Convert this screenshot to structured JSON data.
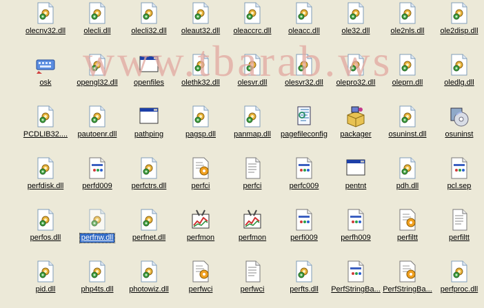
{
  "watermark": "www.tbarab.ws",
  "selected_index": 37,
  "colors": {
    "selection": "#316AC5",
    "background": "#ECE9D8"
  },
  "items": [
    {
      "label": "olecnv32.dll",
      "icon": "dll-icon"
    },
    {
      "label": "olecli.dll",
      "icon": "dll-icon"
    },
    {
      "label": "olecli32.dll",
      "icon": "dll-icon"
    },
    {
      "label": "oleaut32.dll",
      "icon": "dll-icon"
    },
    {
      "label": "oleaccrc.dll",
      "icon": "dll-icon"
    },
    {
      "label": "oleacc.dll",
      "icon": "dll-icon"
    },
    {
      "label": "ole32.dll",
      "icon": "dll-icon"
    },
    {
      "label": "ole2nls.dll",
      "icon": "dll-icon"
    },
    {
      "label": "ole2disp.dll",
      "icon": "dll-icon"
    },
    {
      "label": "osk",
      "icon": "keyboard-icon"
    },
    {
      "label": "opengl32.dll",
      "icon": "dll-icon"
    },
    {
      "label": "openfiles",
      "icon": "window-icon"
    },
    {
      "label": "olethk32.dll",
      "icon": "dll-icon"
    },
    {
      "label": "olesvr.dll",
      "icon": "dll-icon"
    },
    {
      "label": "olesvr32.dll",
      "icon": "dll-icon"
    },
    {
      "label": "olepro32.dll",
      "icon": "dll-icon"
    },
    {
      "label": "oleprn.dll",
      "icon": "dll-icon"
    },
    {
      "label": "oledlg.dll",
      "icon": "dll-icon"
    },
    {
      "label": "PCDLIB32....",
      "icon": "dll-icon"
    },
    {
      "label": "pautoenr.dll",
      "icon": "dll-icon"
    },
    {
      "label": "pathping",
      "icon": "window-icon"
    },
    {
      "label": "pagsp.dll",
      "icon": "dll-icon"
    },
    {
      "label": "panmap.dll",
      "icon": "dll-icon"
    },
    {
      "label": "pagefileconfig",
      "icon": "script-icon"
    },
    {
      "label": "packager",
      "icon": "packager-icon"
    },
    {
      "label": "osuninst.dll",
      "icon": "dll-icon"
    },
    {
      "label": "osuninst",
      "icon": "cd-install-icon"
    },
    {
      "label": "perfdisk.dll",
      "icon": "dll-icon"
    },
    {
      "label": "perfd009",
      "icon": "data-file-icon"
    },
    {
      "label": "perfctrs.dll",
      "icon": "dll-icon"
    },
    {
      "label": "perfci",
      "icon": "config-file-icon"
    },
    {
      "label": "perfci",
      "icon": "text-file-icon"
    },
    {
      "label": "perfc009",
      "icon": "data-file-icon"
    },
    {
      "label": "pentnt",
      "icon": "window-icon"
    },
    {
      "label": "pdh.dll",
      "icon": "dll-icon"
    },
    {
      "label": "pcl.sep",
      "icon": "data-file-icon"
    },
    {
      "label": "perfos.dll",
      "icon": "dll-icon"
    },
    {
      "label": "perfnw.dll",
      "icon": "dll-icon"
    },
    {
      "label": "perfnet.dll",
      "icon": "dll-icon"
    },
    {
      "label": "perfmon",
      "icon": "perfmon-icon"
    },
    {
      "label": "perfmon",
      "icon": "perfmon-icon"
    },
    {
      "label": "perfi009",
      "icon": "data-file-icon"
    },
    {
      "label": "perfh009",
      "icon": "data-file-icon"
    },
    {
      "label": "perfiltt",
      "icon": "config-file-icon"
    },
    {
      "label": "perfiltt",
      "icon": "text-file-icon"
    },
    {
      "label": "pid.dll",
      "icon": "dll-icon"
    },
    {
      "label": "php4ts.dll",
      "icon": "dll-icon"
    },
    {
      "label": "photowiz.dll",
      "icon": "dll-icon"
    },
    {
      "label": "perfwci",
      "icon": "config-file-icon"
    },
    {
      "label": "perfwci",
      "icon": "text-file-icon"
    },
    {
      "label": "perfts.dll",
      "icon": "dll-icon"
    },
    {
      "label": "PerfStringBa...",
      "icon": "data-file-icon"
    },
    {
      "label": "PerfStringBa...",
      "icon": "config-file-icon"
    },
    {
      "label": "perfproc.dll",
      "icon": "dll-icon"
    }
  ]
}
